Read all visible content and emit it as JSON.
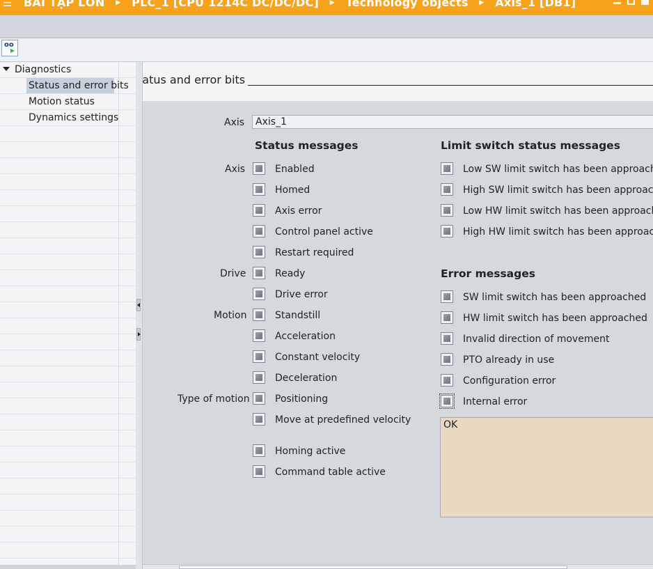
{
  "titlebar": {
    "breadcrumbs": [
      "BÀI TẬP LỚN",
      "PLC_1 [CPU 1214C DC/DC/DC]",
      "Technology objects",
      "Axis_1 [DB1]"
    ],
    "accent_color": "#f7a21b"
  },
  "toolbar": {
    "monitor_button_icon": "monitoring-glasses-icon"
  },
  "nav": {
    "root": "Diagnostics",
    "items": [
      "Status and error bits",
      "Motion status",
      "Dynamics settings"
    ],
    "selected_index": 0
  },
  "main": {
    "section_title": "tatus and error bits",
    "axis_label": "Axis",
    "axis_value": "Axis_1",
    "status_messages": {
      "title": "Status messages",
      "groups": [
        "Axis",
        "Drive",
        "Motion",
        "Type of motion"
      ],
      "items": [
        "Enabled",
        "Homed",
        "Axis error",
        "Control panel active",
        "Restart required",
        "Ready",
        "Drive error",
        "Standstill",
        "Acceleration",
        "Constant velocity",
        "Deceleration",
        "Positioning",
        "Move at predefined velocity",
        "Homing active",
        "Command table active"
      ]
    },
    "limit_switch_messages": {
      "title": "Limit switch status messages",
      "items": [
        "Low SW limit switch has been approached",
        "High SW limit switch has been approached",
        "Low HW limit switch has been approached",
        "High HW limit switch has been approached"
      ]
    },
    "error_messages": {
      "title": "Error messages",
      "items": [
        "SW limit switch has been approached",
        "HW limit switch has been approached",
        "Invalid direction of movement",
        "PTO already in use",
        "Configuration error",
        "Internal error"
      ]
    },
    "message_box_text": "OK"
  }
}
